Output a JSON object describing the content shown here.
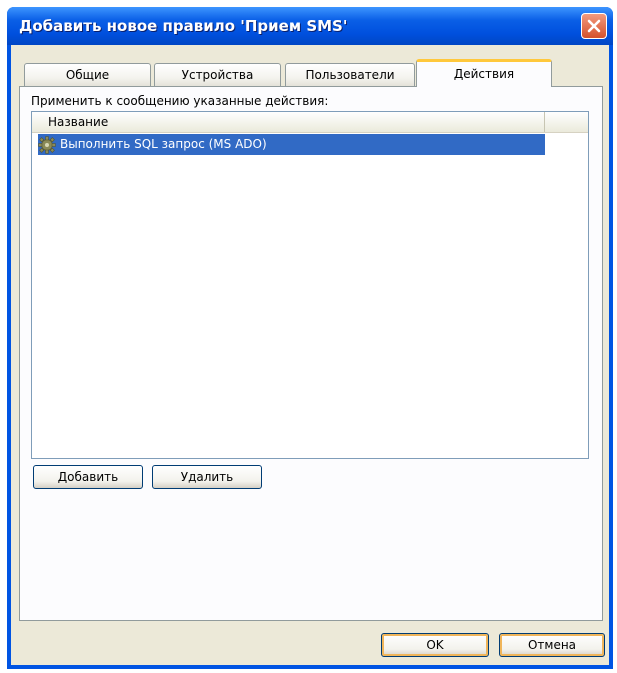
{
  "window": {
    "title": "Добавить новое правило 'Прием SMS'"
  },
  "tabs": [
    {
      "label": "Общие"
    },
    {
      "label": "Устройства"
    },
    {
      "label": "Пользователи"
    },
    {
      "label": "Действия",
      "active": true
    }
  ],
  "panel": {
    "label": "Применить к сообщению указанные действия:",
    "list": {
      "columns": [
        {
          "label": "Название"
        }
      ],
      "rows": [
        {
          "icon": "gear-icon",
          "label": "Выполнить SQL запрос (MS ADO)",
          "selected": true
        }
      ]
    },
    "buttons": {
      "add": "Добавить",
      "remove": "Удалить"
    }
  },
  "dialog_buttons": {
    "ok": "OK",
    "cancel": "Отмена"
  },
  "colors": {
    "selection": "#316ac5",
    "title_bar": "#0054e3",
    "dialog_bg": "#ece9d8",
    "active_tab_accent": "#ffc83c"
  }
}
